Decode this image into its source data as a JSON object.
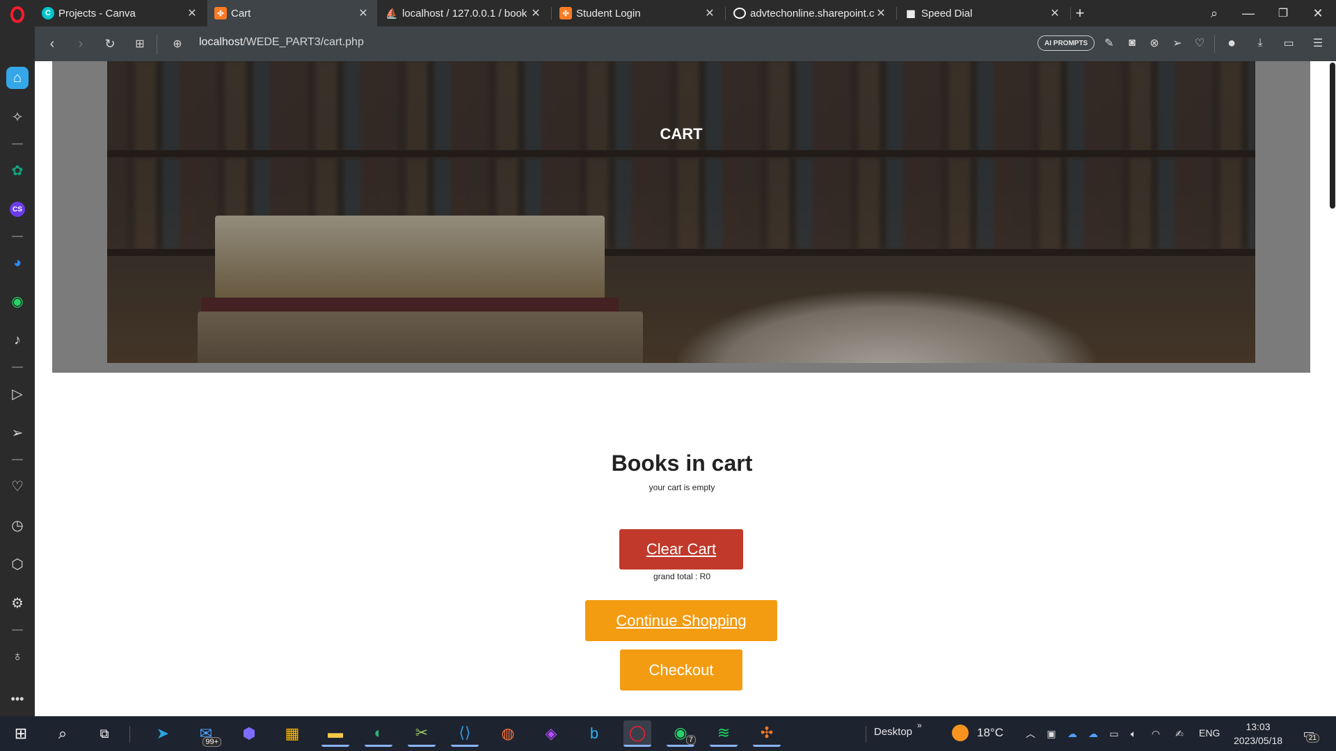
{
  "browser": {
    "tabs": [
      {
        "title": "Projects - Canva",
        "favicon": "canva-icon",
        "color": "#00c4cc",
        "active": false
      },
      {
        "title": "Cart",
        "favicon": "xampp-icon",
        "color": "#fb7a24",
        "active": true
      },
      {
        "title": "localhost / 127.0.0.1 / book",
        "favicon": "phpmyadmin-icon",
        "color": "#f29c25",
        "active": false
      },
      {
        "title": "Student Login",
        "favicon": "xampp-icon",
        "color": "#fb7a24",
        "active": false
      },
      {
        "title": "advtechonline.sharepoint.c",
        "favicon": "globe-icon",
        "color": "#ffffff",
        "active": false
      },
      {
        "title": "Speed Dial",
        "favicon": "speed-dial-icon",
        "color": "#ffffff",
        "active": false
      }
    ],
    "address": {
      "host": "localhost",
      "path": "/WEDE_PART3/cart.php"
    },
    "ai_prompts_label": "AI PROMPTS"
  },
  "page": {
    "hero_title": "CART",
    "books_heading": "Books in cart",
    "cart_status": "your cart is empty",
    "clear_cart_label": "Clear Cart",
    "grand_total": "grand total : R0",
    "continue_label": "Continue Shopping",
    "checkout_label": "Checkout",
    "colors": {
      "clear": "#c0392b",
      "primary": "#f39c12"
    }
  },
  "taskbar": {
    "desktop_label": "Desktop",
    "temperature": "18°C",
    "language": "ENG",
    "time": "13:03",
    "date": "2023/05/18",
    "mail_badge": "99+",
    "whatsapp_badge": "7",
    "notification_badge": "21"
  }
}
